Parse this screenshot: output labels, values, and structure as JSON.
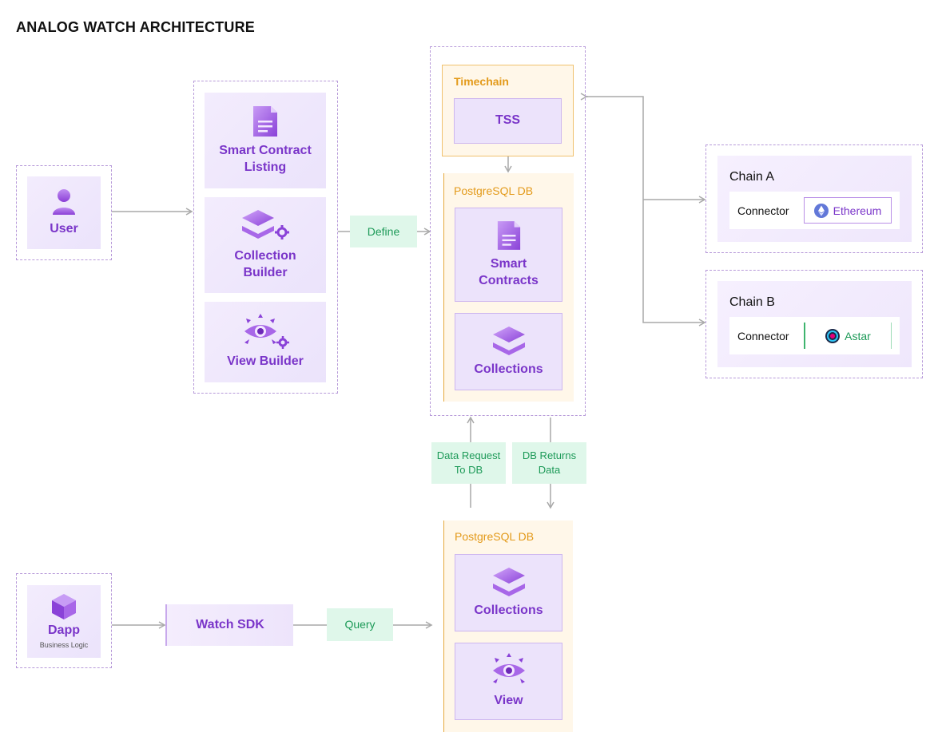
{
  "title": "ANALOG WATCH ARCHITECTURE",
  "user": {
    "label": "User",
    "icon": "user-icon"
  },
  "builders": [
    {
      "label_line1": "Smart Contract",
      "label_line2": "Listing",
      "icon": "document-icon"
    },
    {
      "label_line1": "Collection",
      "label_line2": "Builder",
      "icon": "layers-gear-icon"
    },
    {
      "label_line1": "View Builder",
      "label_line2": "",
      "icon": "eye-gear-icon"
    }
  ],
  "define_label": "Define",
  "timechain": {
    "label": "Timechain",
    "tss_label": "TSS"
  },
  "postgres_top": {
    "label": "PostgreSQL DB",
    "smart_contracts_line1": "Smart",
    "smart_contracts_line2": "Contracts",
    "collections_label": "Collections"
  },
  "chains": [
    {
      "title": "Chain A",
      "connector_label": "Connector",
      "network": "Ethereum",
      "icon": "ethereum-icon"
    },
    {
      "title": "Chain B",
      "connector_label": "Connector",
      "network": "Astar",
      "icon": "astar-icon"
    }
  ],
  "data_request": {
    "line1": "Data Request",
    "line2": "To DB"
  },
  "db_returns": {
    "line1": "DB Returns",
    "line2": "Data"
  },
  "postgres_bottom": {
    "label": "PostgreSQL DB",
    "collections_label": "Collections",
    "view_label": "View"
  },
  "dapp": {
    "label": "Dapp",
    "sublabel": "Business Logic",
    "icon": "cube-icon"
  },
  "watch_sdk_label": "Watch SDK",
  "query_label": "Query",
  "colors": {
    "purple": "#7a35c9",
    "orange": "#e39a1a",
    "green": "#1d9a58",
    "arrow": "#a9a9a9"
  }
}
